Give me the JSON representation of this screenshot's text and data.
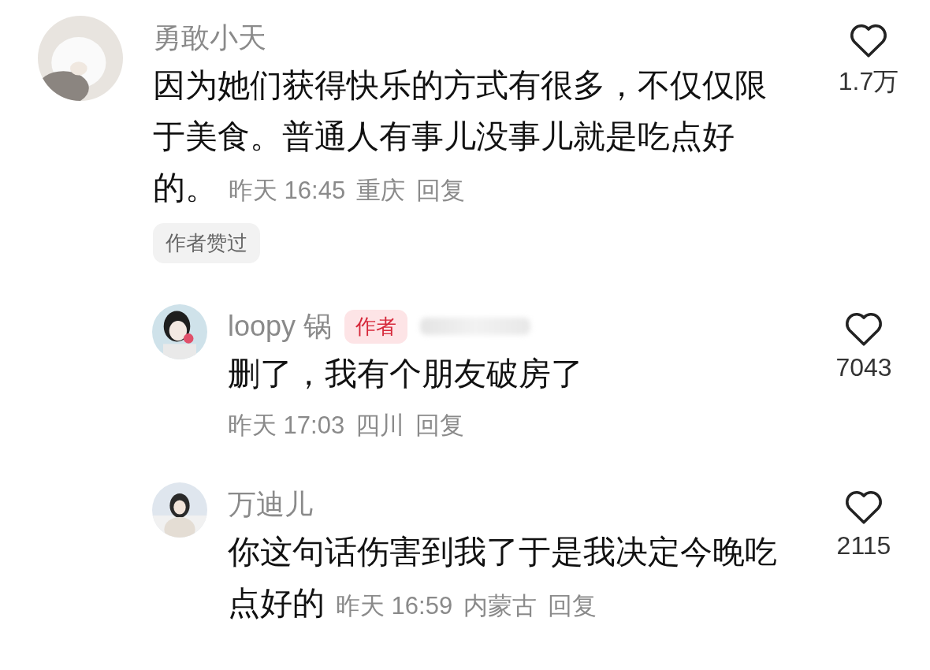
{
  "comments": [
    {
      "user": "勇敢小天",
      "avatar": {
        "kind": "picture"
      },
      "text_lines": [
        "因为她们获得快乐的方式有很多，不仅仅限",
        "于美食。普通人有事儿没事儿就是吃点好",
        "的。"
      ],
      "time": "昨天 16:45",
      "location": "重庆",
      "reply_label": "回复",
      "likes": "1.7万",
      "liked": false,
      "author_liked_label": "作者赞过",
      "children": [
        {
          "user": "loopy 锅",
          "badge": "作者",
          "avatar": {
            "kind": "picture"
          },
          "text_lines": [
            "删了，我有个朋友破房了"
          ],
          "meta_own_line": true,
          "time": "昨天 17:03",
          "location": "四川",
          "reply_label": "回复",
          "likes": "7043",
          "liked": false
        },
        {
          "user": "万迪儿",
          "avatar": {
            "kind": "picture"
          },
          "text_lines": [
            "你这句话伤害到我了于是我决定今晚吃",
            "点好的"
          ],
          "time": "昨天 16:59",
          "location": "内蒙古",
          "reply_label": "回复",
          "likes": "2115",
          "liked": false
        }
      ]
    }
  ]
}
